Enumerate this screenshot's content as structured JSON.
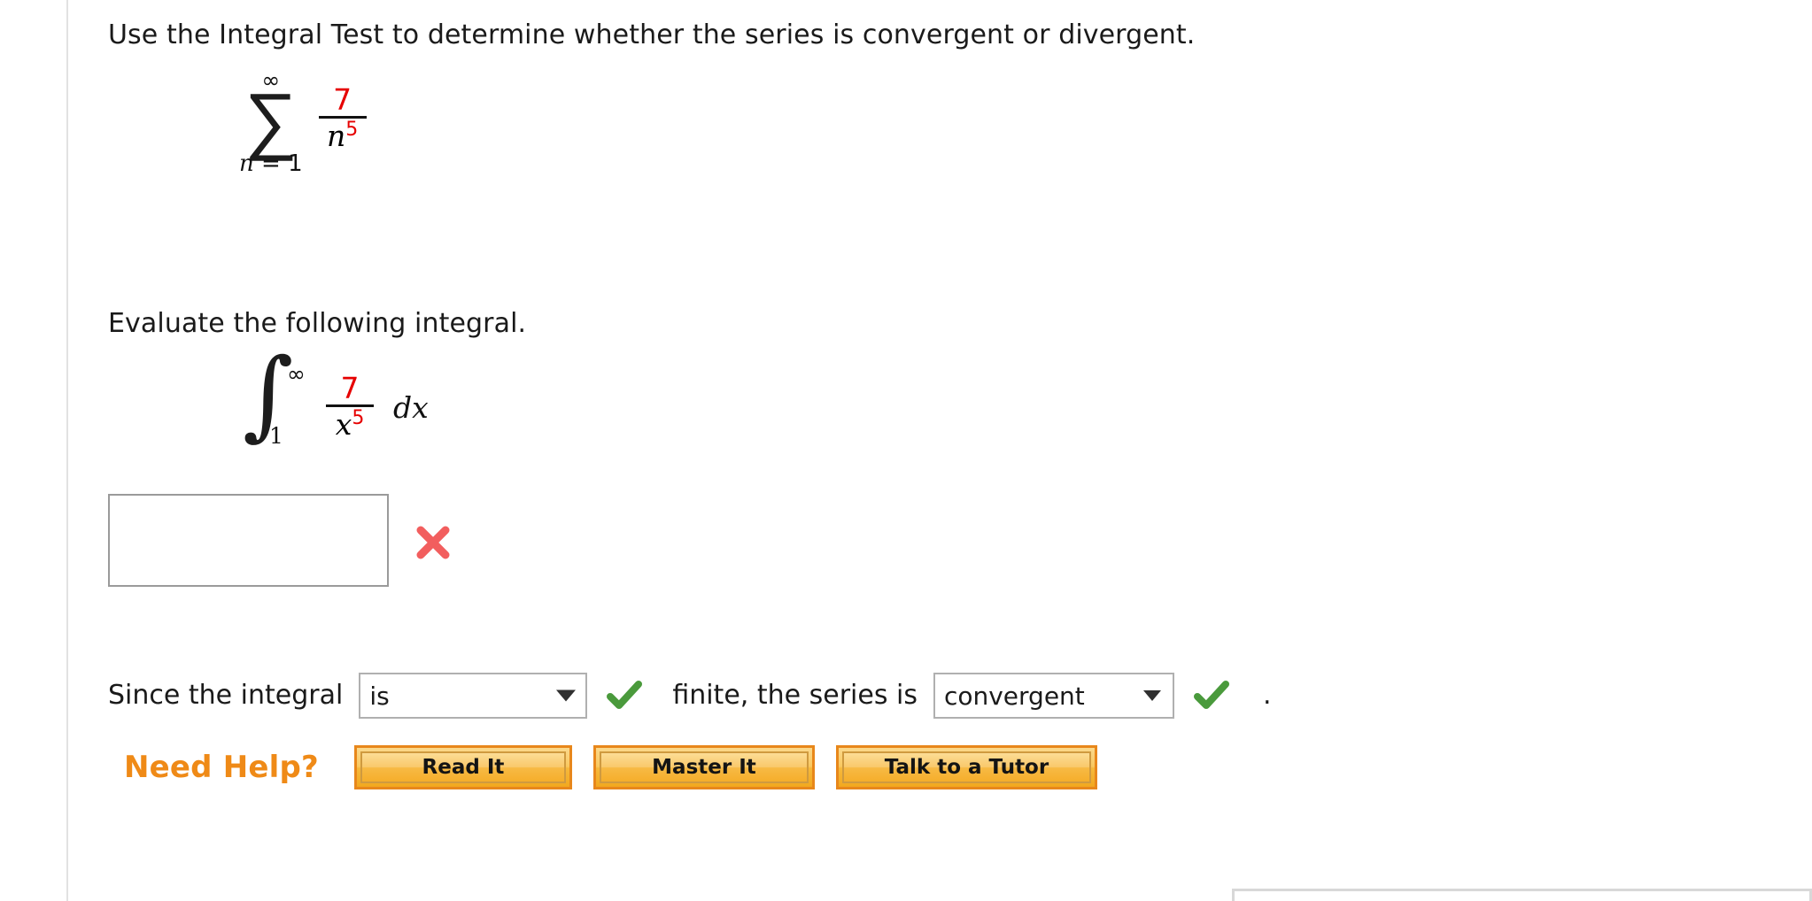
{
  "prompt": {
    "main": "Use the Integral Test to determine whether the series is convergent or divergent.",
    "evaluate": "Evaluate the following integral."
  },
  "series": {
    "sigma_glyph": "∑",
    "upper_limit": "∞",
    "lower_index": "n",
    "lower_equals": " = ",
    "lower_value": "1",
    "numerator": "7",
    "denominator_base": "n",
    "denominator_exponent": "5"
  },
  "integral": {
    "integral_glyph": "∫",
    "upper_limit": "∞",
    "lower_limit": "1",
    "numerator": "7",
    "denominator_base": "x",
    "denominator_exponent": "5",
    "differential": "dx"
  },
  "answer": {
    "value": "",
    "placeholder": "",
    "result_icon": "red-x-incorrect-icon"
  },
  "conclusion": {
    "lead_text": "Since the integral",
    "integral_state_value": "is",
    "integral_state_icon": "green-check-correct-icon",
    "middle_text": "finite, the series is",
    "series_state_value": "convergent",
    "series_state_icon": "green-check-correct-icon",
    "period": "."
  },
  "help": {
    "label": "Need Help?",
    "buttons": [
      {
        "label": "Read It"
      },
      {
        "label": "Master It"
      },
      {
        "label": "Talk to a Tutor"
      }
    ]
  },
  "colors": {
    "accent_orange": "#ef8a17",
    "math_red": "#e60000",
    "correct_green": "#4a9a3c",
    "incorrect_red": "#f25e5e",
    "rule_gray": "#e2e2e2"
  }
}
